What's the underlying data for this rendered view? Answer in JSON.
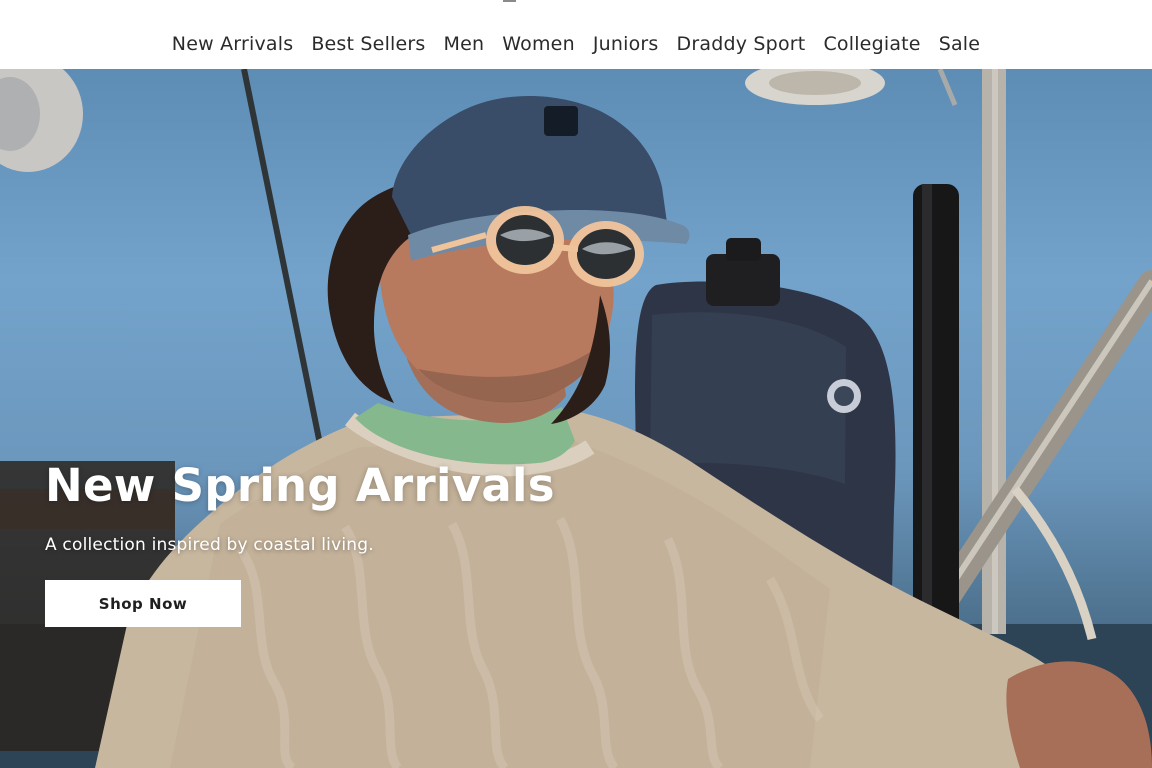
{
  "nav": {
    "items": [
      {
        "label": "New Arrivals"
      },
      {
        "label": "Best Sellers"
      },
      {
        "label": "Men"
      },
      {
        "label": "Women"
      },
      {
        "label": "Juniors"
      },
      {
        "label": "Draddy Sport"
      },
      {
        "label": "Collegiate"
      },
      {
        "label": "Sale"
      }
    ]
  },
  "hero": {
    "heading": "New Spring Arrivals",
    "subtitle": "A collection inspired by coastal living.",
    "cta_label": "Shop Now"
  },
  "colors": {
    "nav_text": "#2b2b2b",
    "hero_text": "#ffffff",
    "button_bg": "#ffffff",
    "button_text": "#1f1f1f"
  }
}
